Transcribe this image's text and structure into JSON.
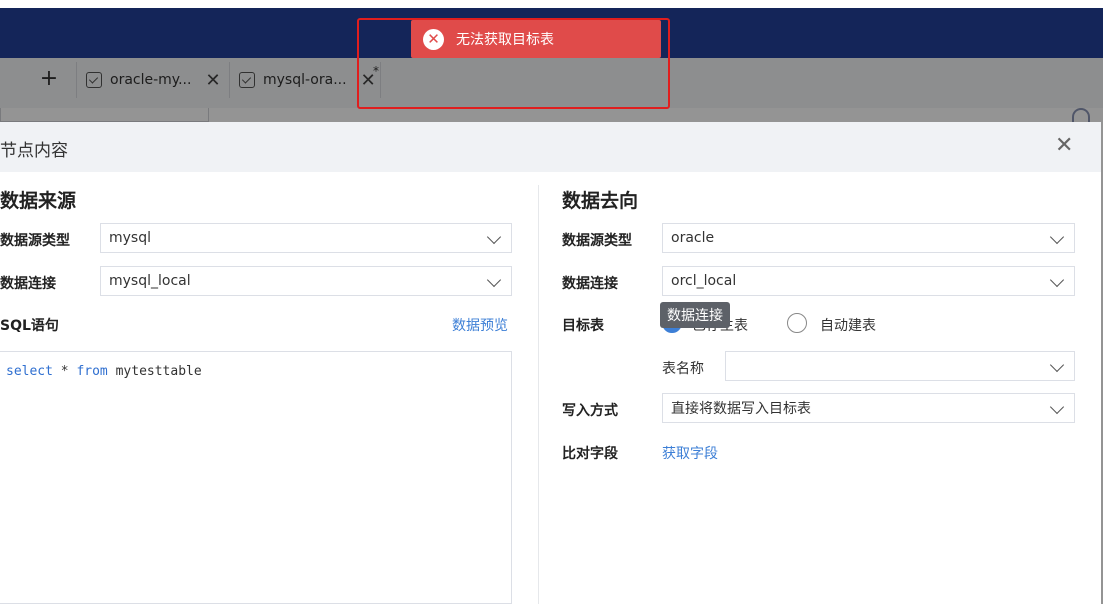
{
  "tabs": [
    {
      "label": "oracle-my..."
    },
    {
      "label": "mysql-ora..."
    }
  ],
  "tab_modified_marker": "*",
  "toast": {
    "message": "无法获取目标表",
    "icon": "error-circle-icon",
    "color": "#e04b4a"
  },
  "modal": {
    "title": "节点内容",
    "source": {
      "title": "数据来源",
      "datasource_type_label": "数据源类型",
      "datasource_type_value": "mysql",
      "connection_label": "数据连接",
      "connection_value": "mysql_local",
      "sql_label": "SQL语句",
      "preview_link": "数据预览",
      "sql": {
        "kw1": "select",
        "mid": " * ",
        "kw2": "from",
        "table": " mytesttable"
      }
    },
    "target": {
      "title": "数据去向",
      "datasource_type_label": "数据源类型",
      "datasource_type_value": "oracle",
      "connection_label": "数据连接",
      "connection_value": "orcl_local",
      "target_table_label": "目标表",
      "radio_existing_label": "已有表",
      "radio_existing_visible": "已存主表",
      "radio_auto_label": "自动建表",
      "table_name_label": "表名称",
      "table_name_value": "",
      "write_mode_label": "写入方式",
      "write_mode_value": "直接将数据写入目标表",
      "compare_fields_label": "比对字段",
      "fetch_fields_link": "获取字段"
    },
    "tooltip": "数据连接"
  },
  "colors": {
    "topbar": "#24409a",
    "accent": "#3d7fd6",
    "highlight": "#e01e1e"
  }
}
